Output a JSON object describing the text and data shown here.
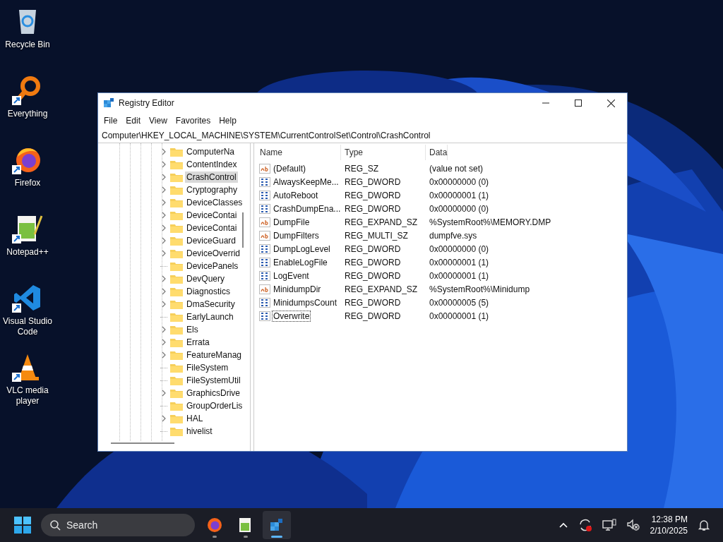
{
  "desktop_icons": [
    {
      "kind": "recycle",
      "label": "Recycle Bin",
      "shortcut": false
    },
    {
      "kind": "everything",
      "label": "Everything",
      "shortcut": true
    },
    {
      "kind": "firefox",
      "label": "Firefox",
      "shortcut": true
    },
    {
      "kind": "notepad",
      "label": "Notepad++",
      "shortcut": true
    },
    {
      "kind": "vscode",
      "label": "Visual Studio Code",
      "shortcut": true
    },
    {
      "kind": "vlc",
      "label": "VLC media player",
      "shortcut": true
    }
  ],
  "window": {
    "title": "Registry Editor",
    "menu": [
      "File",
      "Edit",
      "View",
      "Favorites",
      "Help"
    ],
    "address": "Computer\\HKEY_LOCAL_MACHINE\\SYSTEM\\CurrentControlSet\\Control\\CrashControl",
    "tree": [
      {
        "label": "ComputerNa",
        "expandable": true,
        "selected": false
      },
      {
        "label": "ContentIndex",
        "expandable": true,
        "selected": false
      },
      {
        "label": "CrashControl",
        "expandable": true,
        "selected": true
      },
      {
        "label": "Cryptography",
        "expandable": true,
        "selected": false
      },
      {
        "label": "DeviceClasses",
        "expandable": true,
        "selected": false
      },
      {
        "label": "DeviceContai",
        "expandable": true,
        "selected": false
      },
      {
        "label": "DeviceContai",
        "expandable": true,
        "selected": false
      },
      {
        "label": "DeviceGuard",
        "expandable": true,
        "selected": false
      },
      {
        "label": "DeviceOverrid",
        "expandable": true,
        "selected": false
      },
      {
        "label": "DevicePanels",
        "expandable": false,
        "selected": false
      },
      {
        "label": "DevQuery",
        "expandable": true,
        "selected": false
      },
      {
        "label": "Diagnostics",
        "expandable": true,
        "selected": false
      },
      {
        "label": "DmaSecurity",
        "expandable": true,
        "selected": false
      },
      {
        "label": "EarlyLaunch",
        "expandable": false,
        "selected": false
      },
      {
        "label": "Els",
        "expandable": true,
        "selected": false
      },
      {
        "label": "Errata",
        "expandable": true,
        "selected": false
      },
      {
        "label": "FeatureManag",
        "expandable": true,
        "selected": false
      },
      {
        "label": "FileSystem",
        "expandable": false,
        "selected": false
      },
      {
        "label": "FileSystemUtil",
        "expandable": false,
        "selected": false
      },
      {
        "label": "GraphicsDrive",
        "expandable": true,
        "selected": false
      },
      {
        "label": "GroupOrderLis",
        "expandable": false,
        "selected": false
      },
      {
        "label": "HAL",
        "expandable": true,
        "selected": false
      },
      {
        "label": "hivelist",
        "expandable": false,
        "selected": false
      }
    ],
    "columns": [
      "Name",
      "Type",
      "Data"
    ],
    "rows": [
      {
        "kind": "string",
        "name": "(Default)",
        "type": "REG_SZ",
        "data": "(value not set)",
        "focused": false
      },
      {
        "kind": "binary",
        "name": "AlwaysKeepMe...",
        "type": "REG_DWORD",
        "data": "0x00000000 (0)",
        "focused": false
      },
      {
        "kind": "binary",
        "name": "AutoReboot",
        "type": "REG_DWORD",
        "data": "0x00000001 (1)",
        "focused": false
      },
      {
        "kind": "binary",
        "name": "CrashDumpEna...",
        "type": "REG_DWORD",
        "data": "0x00000000 (0)",
        "focused": false
      },
      {
        "kind": "string",
        "name": "DumpFile",
        "type": "REG_EXPAND_SZ",
        "data": "%SystemRoot%\\MEMORY.DMP",
        "focused": false
      },
      {
        "kind": "string",
        "name": "DumpFilters",
        "type": "REG_MULTI_SZ",
        "data": "dumpfve.sys",
        "focused": false
      },
      {
        "kind": "binary",
        "name": "DumpLogLevel",
        "type": "REG_DWORD",
        "data": "0x00000000 (0)",
        "focused": false
      },
      {
        "kind": "binary",
        "name": "EnableLogFile",
        "type": "REG_DWORD",
        "data": "0x00000001 (1)",
        "focused": false
      },
      {
        "kind": "binary",
        "name": "LogEvent",
        "type": "REG_DWORD",
        "data": "0x00000001 (1)",
        "focused": false
      },
      {
        "kind": "string",
        "name": "MinidumpDir",
        "type": "REG_EXPAND_SZ",
        "data": "%SystemRoot%\\Minidump",
        "focused": false
      },
      {
        "kind": "binary",
        "name": "MinidumpsCount",
        "type": "REG_DWORD",
        "data": "0x00000005 (5)",
        "focused": false
      },
      {
        "kind": "binary",
        "name": "Overwrite",
        "type": "REG_DWORD",
        "data": "0x00000001 (1)",
        "focused": true
      }
    ]
  },
  "taskbar": {
    "search": {
      "placeholder": "Search"
    },
    "apps": [
      {
        "kind": "firefox",
        "selected": false
      },
      {
        "kind": "notepad",
        "selected": false
      },
      {
        "kind": "regedit",
        "selected": true
      }
    ],
    "clock": {
      "time": "12:38 PM",
      "date": "2/10/2025"
    }
  }
}
